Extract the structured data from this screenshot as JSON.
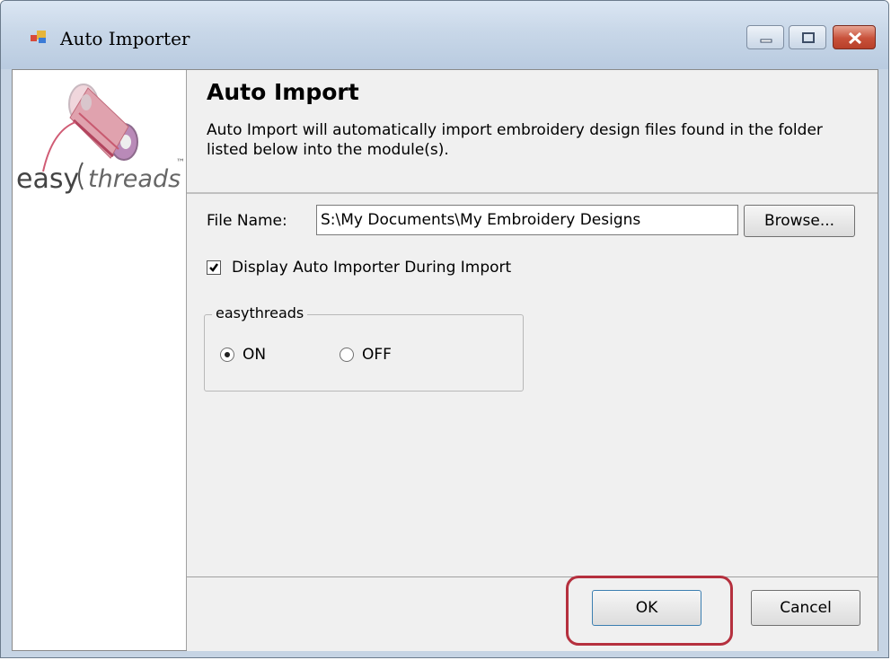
{
  "window": {
    "title": "Auto Importer"
  },
  "header": {
    "title": "Auto Import",
    "description": "Auto Import will automatically import embroidery design files found in the folder listed below into the module(s)."
  },
  "logo": {
    "text_left": "easy",
    "text_right": "threads",
    "trademark": "™"
  },
  "form": {
    "file_name_label": "File Name:",
    "file_name_value": "S:\\My Documents\\My Embroidery Designs",
    "browse_label": "Browse...",
    "display_checkbox_label": "Display Auto Importer During Import",
    "display_checkbox_checked": true
  },
  "group": {
    "title": "easythreads",
    "on_label": "ON",
    "off_label": "OFF",
    "selected": "ON"
  },
  "footer": {
    "ok_label": "OK",
    "cancel_label": "Cancel"
  },
  "colors": {
    "highlight": "#b5303e",
    "title_bar": "#c8d7e8"
  }
}
